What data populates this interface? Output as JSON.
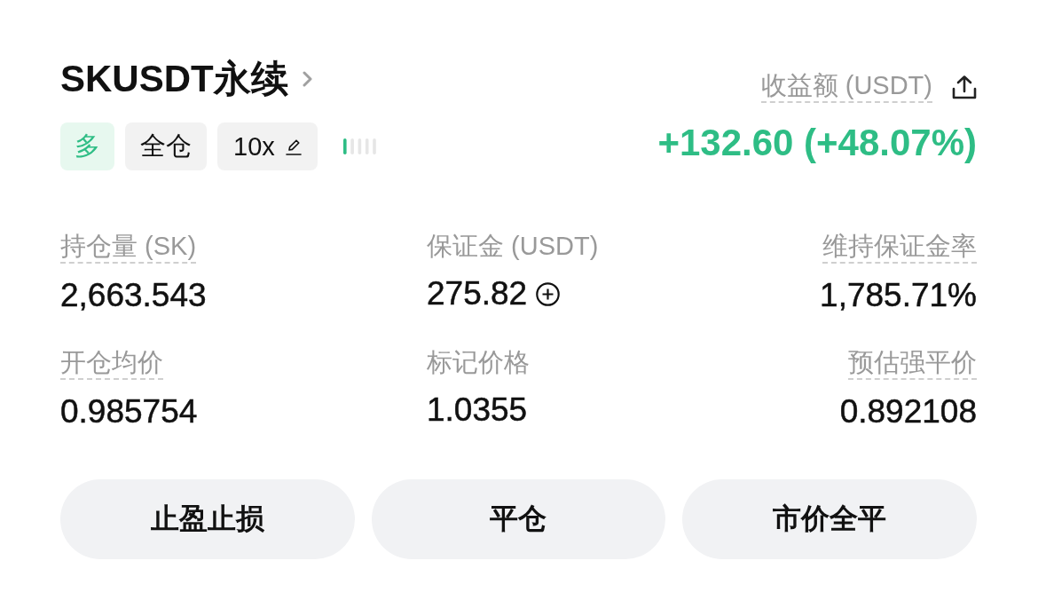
{
  "header": {
    "title": "SKUSDT永续"
  },
  "tags": [
    {
      "kind": "side",
      "label": "多"
    },
    {
      "kind": "mode",
      "label": "全仓"
    },
    {
      "kind": "leverage",
      "label": "10x"
    }
  ],
  "risk_meter": {
    "level": 0.2
  },
  "pnl": {
    "label": "收益额 (USDT)",
    "hint": true,
    "value": "+132.60 (+48.07%)",
    "positive": true
  },
  "stats": [
    {
      "label": "持仓量 (SK)",
      "hint": true,
      "value": "2,663.543",
      "add_button": false
    },
    {
      "label": "保证金 (USDT)",
      "hint": false,
      "value": "275.82",
      "add_button": true
    },
    {
      "label": "维持保证金率",
      "hint": true,
      "value": "1,785.71%",
      "add_button": false
    },
    {
      "label": "开仓均价",
      "hint": true,
      "value": "0.985754",
      "add_button": false
    },
    {
      "label": "标记价格",
      "hint": false,
      "value": "1.0355",
      "add_button": false
    },
    {
      "label": "预估强平价",
      "hint": true,
      "value": "0.892108",
      "add_button": false
    }
  ],
  "buttons": [
    {
      "label": "止盈止损"
    },
    {
      "label": "平仓"
    },
    {
      "label": "市价全平"
    }
  ]
}
